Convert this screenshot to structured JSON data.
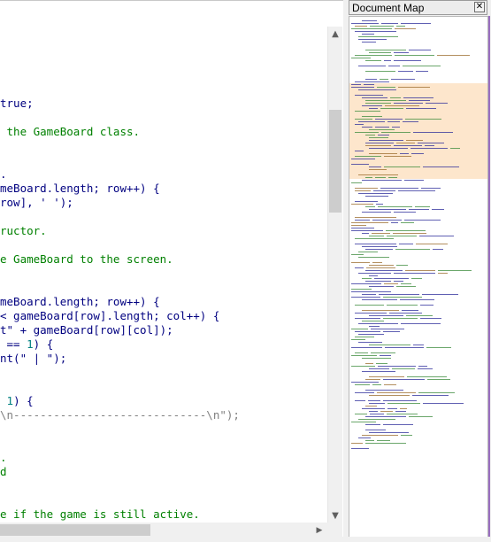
{
  "editor": {
    "lines": [
      {
        "parts": [
          {
            "t": "true;",
            "c": "code"
          }
        ]
      },
      {
        "parts": [
          {
            "t": " the GameBoard class.",
            "c": "comment"
          }
        ]
      },
      {
        "parts": [
          {
            "t": ".",
            "c": "code"
          }
        ]
      },
      {
        "parts": [
          {
            "t": "meBoard.length; row++) {",
            "c": "code"
          }
        ]
      },
      {
        "parts": [
          {
            "t": "row], ' ');",
            "c": "code"
          }
        ]
      },
      {
        "parts": [
          {
            "t": "ructor.",
            "c": "comment"
          }
        ]
      },
      {
        "parts": [
          {
            "t": "e GameBoard to the screen.",
            "c": "comment"
          }
        ]
      },
      {
        "parts": [
          {
            "t": "meBoard.length; row++) {",
            "c": "code"
          }
        ]
      },
      {
        "parts": [
          {
            "t": "< gameBoard[row].length; col++) {",
            "c": "code"
          }
        ]
      },
      {
        "parts": [
          {
            "t": "t\" + gameBoard[row][col]);",
            "c": "code"
          }
        ]
      },
      {
        "parts": [
          {
            "t": " == ",
            "c": "code"
          },
          {
            "t": "1",
            "c": "num"
          },
          {
            "t": ") {",
            "c": "code"
          }
        ]
      },
      {
        "parts": [
          {
            "t": "nt(\" | \");",
            "c": "code"
          }
        ]
      },
      {
        "parts": [
          {
            "t": " ",
            "c": "code"
          },
          {
            "t": "1",
            "c": "num"
          },
          {
            "t": ") {",
            "c": "code"
          }
        ]
      },
      {
        "parts": [
          {
            "t": "\\n-----------------------------\\n\");",
            "c": "str"
          }
        ]
      },
      {
        "parts": [
          {
            "t": ".",
            "c": "comment"
          }
        ]
      },
      {
        "parts": [
          {
            "t": "d",
            "c": "comment"
          }
        ]
      },
      {
        "parts": [
          {
            "t": "e if the game is still active.",
            "c": "comment"
          }
        ]
      }
    ]
  },
  "document_map": {
    "title": "Document Map",
    "close_glyph": "✕"
  },
  "scroll": {
    "up_glyph": "▲",
    "down_glyph": "▼",
    "right_glyph": "▶"
  },
  "colors": {
    "code": "#000080",
    "comment": "#008000",
    "literal": "#008080",
    "string": "#808080",
    "map_highlight": "#fde6cc"
  }
}
